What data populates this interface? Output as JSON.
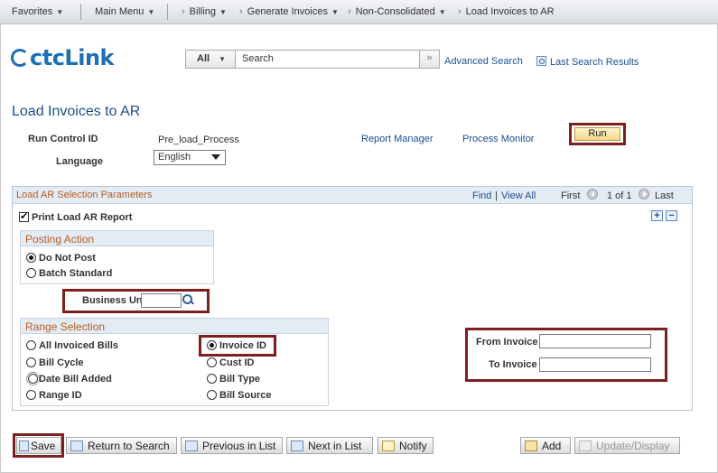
{
  "nav": {
    "favorites": "Favorites",
    "main_menu": "Main Menu",
    "breadcrumb": [
      "Billing",
      "Generate Invoices",
      "Non-Consolidated",
      "Load Invoices to AR"
    ]
  },
  "header": {
    "logo": "ctcLink",
    "search_scope": "All",
    "search_value": "Search",
    "search_go": "»",
    "advanced_search": "Advanced Search",
    "last_search_results": "Last Search Results"
  },
  "page": {
    "title": "Load Invoices to AR",
    "run_control_label": "Run Control ID",
    "run_control_value": "Pre_load_Process",
    "report_manager": "Report Manager",
    "process_monitor": "Process Monitor",
    "run_button": "Run",
    "language_label": "Language",
    "language_value": "English"
  },
  "params": {
    "title": "Load AR Selection Parameters",
    "find": "Find",
    "view_all": "View All",
    "first": "First",
    "count": "1 of 1",
    "last": "Last",
    "plus": "+",
    "minus": "−",
    "print_report_label": "Print Load AR Report",
    "print_report_checked": true,
    "posting_action": {
      "title": "Posting Action",
      "options": [
        "Do Not Post",
        "Batch Standard"
      ],
      "selected": "Do Not Post"
    },
    "business_unit_label": "Business Unit",
    "business_unit_value": "",
    "range_selection": {
      "title": "Range Selection",
      "options": [
        "All Invoiced Bills",
        "Invoice ID",
        "Bill Cycle",
        "Cust ID",
        "Date Bill Added",
        "Bill Type",
        "Range ID",
        "Bill Source"
      ],
      "selected": "Invoice ID"
    },
    "from_invoice_label": "From Invoice",
    "from_invoice_value": "",
    "to_invoice_label": "To Invoice",
    "to_invoice_value": ""
  },
  "toolbar": {
    "save": "Save",
    "return_to_search": "Return to Search",
    "previous_in_list": "Previous in List",
    "next_in_list": "Next in List",
    "notify": "Notify",
    "add": "Add",
    "update_display": "Update/Display"
  }
}
